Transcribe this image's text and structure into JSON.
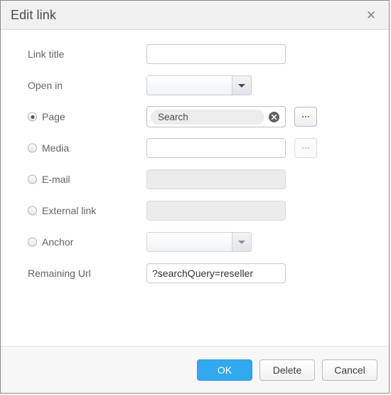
{
  "dialog": {
    "title": "Edit link",
    "close_icon": "close-icon"
  },
  "form": {
    "link_title": {
      "label": "Link title",
      "value": "",
      "placeholder": ""
    },
    "open_in": {
      "label": "Open in",
      "value": ""
    },
    "page": {
      "label": "Page",
      "selected": true,
      "tag_value": "Search",
      "clear_icon": "clear-circle-icon",
      "browse_label": "...",
      "browse_enabled": true
    },
    "media": {
      "label": "Media",
      "selected": false,
      "value": "",
      "browse_label": "...",
      "browse_enabled": false
    },
    "email": {
      "label": "E-mail",
      "selected": false,
      "value": "",
      "disabled": true
    },
    "external_link": {
      "label": "External link",
      "selected": false,
      "value": "",
      "disabled": true
    },
    "anchor": {
      "label": "Anchor",
      "selected": false,
      "value": ""
    },
    "remaining_url": {
      "label": "Remaining Url",
      "value": "?searchQuery=reseller"
    }
  },
  "footer": {
    "ok_label": "OK",
    "delete_label": "Delete",
    "cancel_label": "Cancel"
  },
  "colors": {
    "accent": "#32a8ef",
    "title_text": "#4a4a4a",
    "label_text": "#636363",
    "titlebar_bg": "#f1f1f1",
    "footer_bg": "#f7f7f7"
  }
}
